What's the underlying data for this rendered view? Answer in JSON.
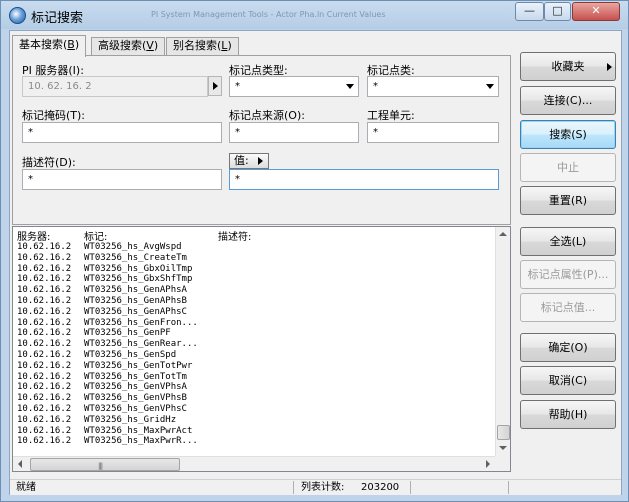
{
  "window": {
    "title": "标记搜索",
    "background_title": "PI System Management Tools - Actor Pha.ln Current Values",
    "buttons": {
      "minimize": "—",
      "maximize": "□",
      "close": "✕"
    }
  },
  "tabs": [
    {
      "label": "基本搜索(",
      "key": "B",
      "suffix": ")"
    },
    {
      "label": "高级搜索(",
      "key": "V",
      "suffix": ")"
    },
    {
      "label": "别名搜索(",
      "key": "L",
      "suffix": ")"
    }
  ],
  "form": {
    "server_label": "PI 服务器(I):",
    "server_value": "10. 62. 16. 2",
    "point_type_label": "标记点类型:",
    "point_type_value": "*",
    "point_class_label": "标记点类:",
    "point_class_value": "*",
    "tag_mask_label": "标记掩码(T):",
    "tag_mask_value": "*",
    "point_source_label": "标记点来源(O):",
    "point_source_value": "*",
    "eng_units_label": "工程单元:",
    "eng_units_value": "*",
    "descriptor_label": "描述符(D):",
    "descriptor_value": "*",
    "value_button_label": "值:",
    "value_value": "*"
  },
  "side_buttons": {
    "favorites": "收藏夹",
    "connect": "连接(C)...",
    "search": "搜索(S)",
    "stop": "中止",
    "reset": "重置(R)",
    "select_all": "全选(L)",
    "tag_attributes": "标记点属性(P)...",
    "tag_values": "标记点值...",
    "ok": "确定(O)",
    "cancel": "取消(C)",
    "help": "帮助(H)"
  },
  "list": {
    "headers": {
      "server": "服务器:",
      "tag": "标记:",
      "descriptor": "描述符:"
    },
    "rows": [
      {
        "server": "10.62.16.2",
        "tag": "WT03256_hs_AvgWspd"
      },
      {
        "server": "10.62.16.2",
        "tag": "WT03256_hs_CreateTm"
      },
      {
        "server": "10.62.16.2",
        "tag": "WT03256_hs_GbxOilTmp"
      },
      {
        "server": "10.62.16.2",
        "tag": "WT03256_hs_GbxShfTmp"
      },
      {
        "server": "10.62.16.2",
        "tag": "WT03256_hs_GenAPhsA"
      },
      {
        "server": "10.62.16.2",
        "tag": "WT03256_hs_GenAPhsB"
      },
      {
        "server": "10.62.16.2",
        "tag": "WT03256_hs_GenAPhsC"
      },
      {
        "server": "10.62.16.2",
        "tag": "WT03256_hs_GenFron..."
      },
      {
        "server": "10.62.16.2",
        "tag": "WT03256_hs_GenPF"
      },
      {
        "server": "10.62.16.2",
        "tag": "WT03256_hs_GenRear..."
      },
      {
        "server": "10.62.16.2",
        "tag": "WT03256_hs_GenSpd"
      },
      {
        "server": "10.62.16.2",
        "tag": "WT03256_hs_GenTotPwr"
      },
      {
        "server": "10.62.16.2",
        "tag": "WT03256_hs_GenTotTm"
      },
      {
        "server": "10.62.16.2",
        "tag": "WT03256_hs_GenVPhsA"
      },
      {
        "server": "10.62.16.2",
        "tag": "WT03256_hs_GenVPhsB"
      },
      {
        "server": "10.62.16.2",
        "tag": "WT03256_hs_GenVPhsC"
      },
      {
        "server": "10.62.16.2",
        "tag": "WT03256_hs_GridHz"
      },
      {
        "server": "10.62.16.2",
        "tag": "WT03256_hs_MaxPwrAct"
      },
      {
        "server": "10.62.16.2",
        "tag": "WT03256_hs_MaxPwrR..."
      }
    ],
    "hscroll_grip": "|||"
  },
  "status": {
    "ready": "就绪",
    "count_label": "列表计数:",
    "count_value": "203200"
  }
}
